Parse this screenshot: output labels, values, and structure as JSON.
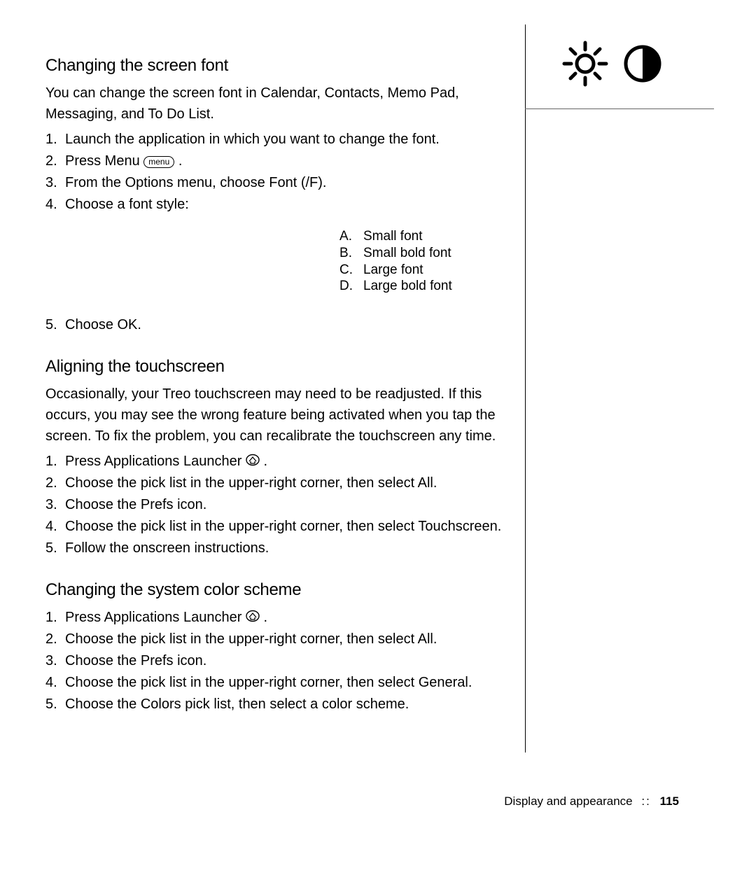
{
  "section1": {
    "heading": "Changing the screen font",
    "intro": "You can change the screen font in Calendar, Contacts, Memo Pad, Messaging, and To Do List.",
    "steps": {
      "s1": "Launch the application in which you want to change the font.",
      "s2a": "Press Menu ",
      "s2b": " .",
      "s3": "From the Options menu, choose Font (/F).",
      "s4": "Choose a font style:",
      "s5": "Choose OK."
    },
    "fonts": {
      "a": "Small font",
      "b": "Small bold font",
      "c": "Large font",
      "d": "Large bold font"
    },
    "menuLabel": "menu"
  },
  "section2": {
    "heading": "Aligning the touchscreen",
    "intro": "Occasionally, your Treo touchscreen may need to be readjusted. If this occurs, you may see the wrong feature being activated when you tap the screen. To fix the problem, you can recalibrate the touchscreen any time.",
    "steps": {
      "s1a": "Press Applications Launcher ",
      "s1b": " .",
      "s2": "Choose the pick list in the upper-right corner, then select All.",
      "s3": "Choose the Prefs icon.",
      "s4": "Choose the pick list in the upper-right corner, then select Touchscreen.",
      "s5": "Follow the onscreen instructions."
    }
  },
  "section3": {
    "heading": "Changing the system color scheme",
    "steps": {
      "s1a": "Press Applications Launcher ",
      "s1b": " .",
      "s2": "Choose the pick list in the upper-right corner, then select All.",
      "s3": "Choose the Prefs icon.",
      "s4": "Choose the pick list in the upper-right corner, then select General.",
      "s5": "Choose the Colors pick list, then select a color scheme."
    }
  },
  "footer": {
    "chapter": "Display and appearance",
    "sep": "::",
    "page": "115"
  }
}
